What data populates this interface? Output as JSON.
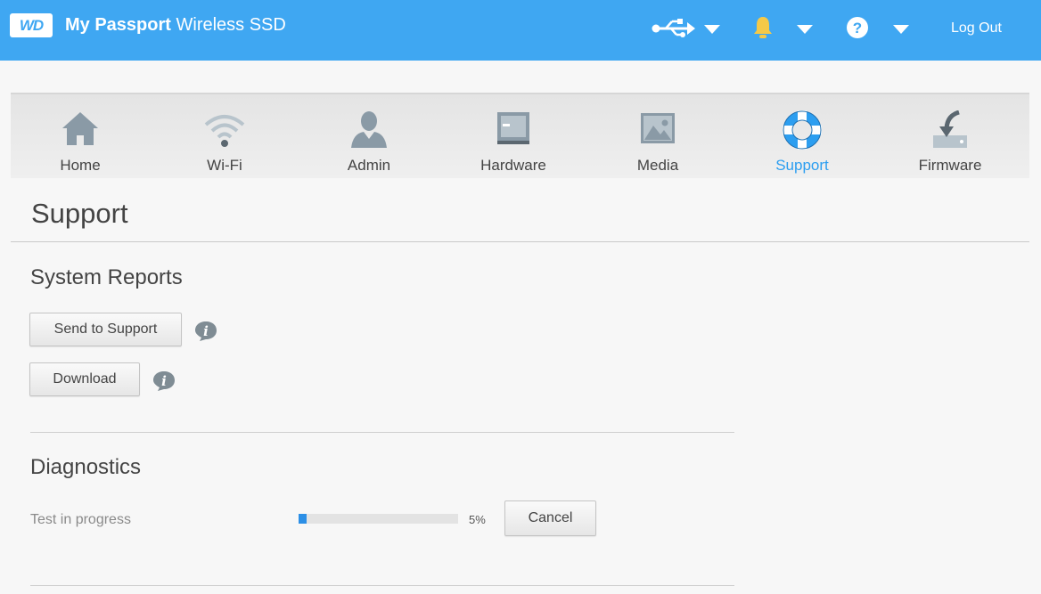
{
  "header": {
    "logo_text": "WD",
    "title_bold": "My Passport",
    "title_rest": " Wireless SSD",
    "usb_icon": "usb-icon",
    "bell_icon": "bell-icon",
    "help_icon": "help-icon",
    "logout_label": "Log Out",
    "accent_color": "#3fa7f2",
    "bell_color": "#f4c948"
  },
  "nav": {
    "items": [
      {
        "label": "Home",
        "icon": "home-icon"
      },
      {
        "label": "Wi-Fi",
        "icon": "wifi-icon"
      },
      {
        "label": "Admin",
        "icon": "admin-icon"
      },
      {
        "label": "Hardware",
        "icon": "hardware-icon"
      },
      {
        "label": "Media",
        "icon": "media-icon"
      },
      {
        "label": "Support",
        "icon": "support-icon",
        "active": true
      },
      {
        "label": "Firmware",
        "icon": "firmware-icon"
      }
    ],
    "active_color": "#2c9ef0"
  },
  "page": {
    "title": "Support"
  },
  "system_reports": {
    "title": "System Reports",
    "send_label": "Send to Support",
    "download_label": "Download"
  },
  "diagnostics": {
    "title": "Diagnostics",
    "status": "Test in progress",
    "progress_percent": 5,
    "progress_label": "5%",
    "cancel_label": "Cancel"
  }
}
